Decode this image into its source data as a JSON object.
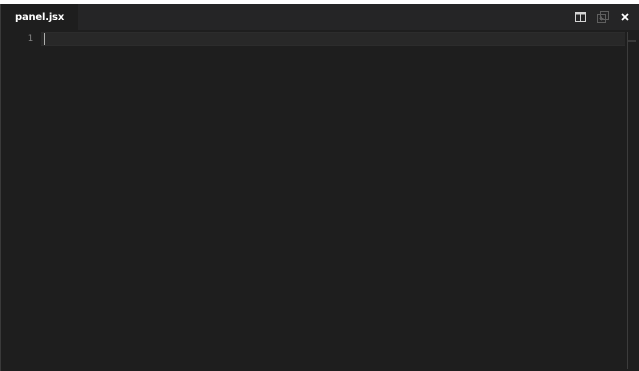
{
  "tab": {
    "title": "panel.jsx"
  },
  "actions": {
    "split_icon": "split-editor-icon",
    "open_changes_icon": "open-changes-icon",
    "close_icon": "close-icon"
  },
  "editor": {
    "line_numbers": [
      "1"
    ],
    "content": ""
  },
  "colors": {
    "background": "#1e1e1e",
    "tab_bar": "#252526",
    "text": "#ffffff",
    "line_number": "#858585"
  }
}
